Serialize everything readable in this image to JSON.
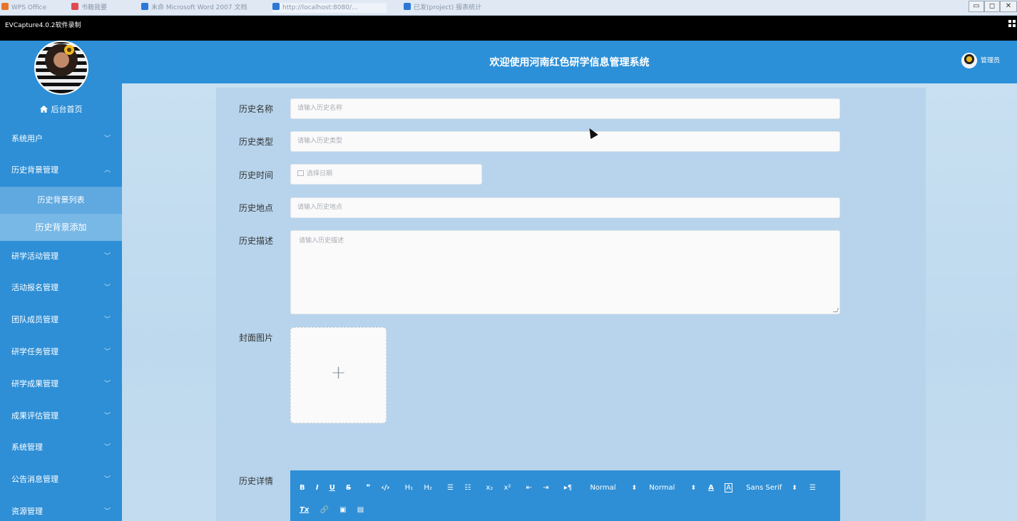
{
  "browser": {
    "tabs": [
      "WPS Office",
      "书籍我要",
      "未命 Microsoft Word 2007 文档",
      "http://localhost:8080/...",
      "已发(project) 报表统计"
    ],
    "window_controls": [
      "▭",
      "◻",
      "✕"
    ]
  },
  "capture_bar": {
    "title": "EVCapture4.0.2软件录制"
  },
  "header": {
    "title": "欢迎使用河南红色研学信息管理系统",
    "admin_label": "管理员"
  },
  "sidebar": {
    "home_label": "后台首页",
    "items": [
      {
        "label": "系统用户",
        "chevron": "﹀"
      },
      {
        "label": "历史背景管理",
        "chevron": "︿"
      },
      {
        "label": "研学活动管理",
        "chevron": "﹀"
      },
      {
        "label": "活动报名管理",
        "chevron": "﹀"
      },
      {
        "label": "团队成员管理",
        "chevron": "﹀"
      },
      {
        "label": "研学任务管理",
        "chevron": "﹀"
      },
      {
        "label": "研学成果管理",
        "chevron": "﹀"
      },
      {
        "label": "成果评估管理",
        "chevron": "﹀"
      },
      {
        "label": "系统管理",
        "chevron": "﹀"
      },
      {
        "label": "公告消息管理",
        "chevron": "﹀"
      },
      {
        "label": "资源管理",
        "chevron": "﹀"
      }
    ],
    "sub_items": [
      {
        "label": "历史背景列表"
      },
      {
        "label": "历史背景添加"
      }
    ]
  },
  "form": {
    "name": {
      "label": "历史名称",
      "placeholder": "请输入历史名称"
    },
    "type": {
      "label": "历史类型",
      "placeholder": "请输入历史类型"
    },
    "time": {
      "label": "历史时间",
      "placeholder": "选择日期"
    },
    "place": {
      "label": "历史地点",
      "placeholder": "请输入历史地点"
    },
    "desc": {
      "label": "历史描述",
      "placeholder": "请输入历史描述"
    },
    "cover": {
      "label": "封面图片",
      "plus": "+"
    },
    "detail": {
      "label": "历史详情"
    }
  },
  "editor": {
    "row1": [
      "B",
      "I",
      "U",
      "S",
      "❞",
      "‹/›",
      "H₁",
      "H₂",
      "☰",
      "☷",
      "x₂",
      "x²",
      "⇤",
      "⇥",
      "▸¶"
    ],
    "pickers": [
      {
        "label": "Normal",
        "arrow": "⬍"
      },
      {
        "label": "Normal",
        "arrow": "⬍"
      }
    ],
    "color_buttons": [
      "A",
      "A"
    ],
    "font_picker": {
      "label": "Sans Serif",
      "arrow": "⬍"
    },
    "align": "☰",
    "row2": [
      "Tx",
      "🔗",
      "▣",
      "▤"
    ]
  },
  "colors": {
    "sidebar": "#2e8fd6",
    "header": "#2c90d8",
    "submenu_active": "#78b8e6",
    "panel": "#b7d4ec"
  }
}
